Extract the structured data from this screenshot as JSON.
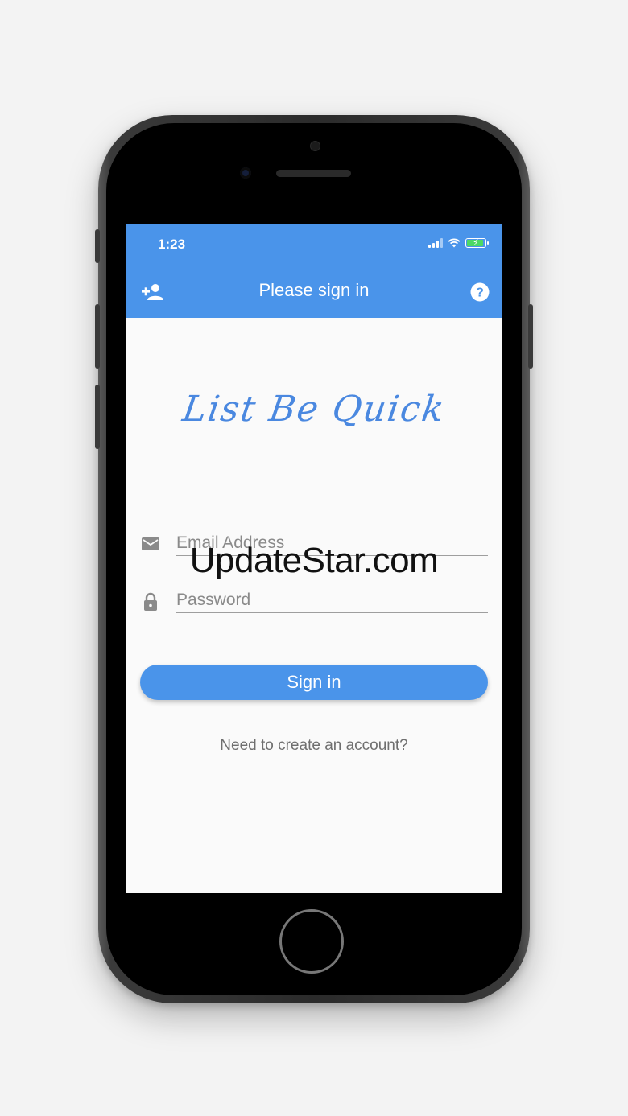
{
  "status_bar": {
    "time": "1:23"
  },
  "app_bar": {
    "title": "Please sign in",
    "left_icon": "add-user-icon",
    "right_icon": "help-icon"
  },
  "logo": {
    "text": "List Be Quick"
  },
  "form": {
    "email": {
      "placeholder": "Email Address",
      "value": "",
      "icon": "mail-icon"
    },
    "password": {
      "placeholder": "Password",
      "value": "",
      "icon": "lock-icon"
    },
    "submit_label": "Sign in",
    "create_account_label": "Need to create an account?"
  },
  "watermark": "UpdateStar.com",
  "colors": {
    "primary": "#4a94ea",
    "background": "#fafafa",
    "icon_grey": "#8a8a8a"
  }
}
